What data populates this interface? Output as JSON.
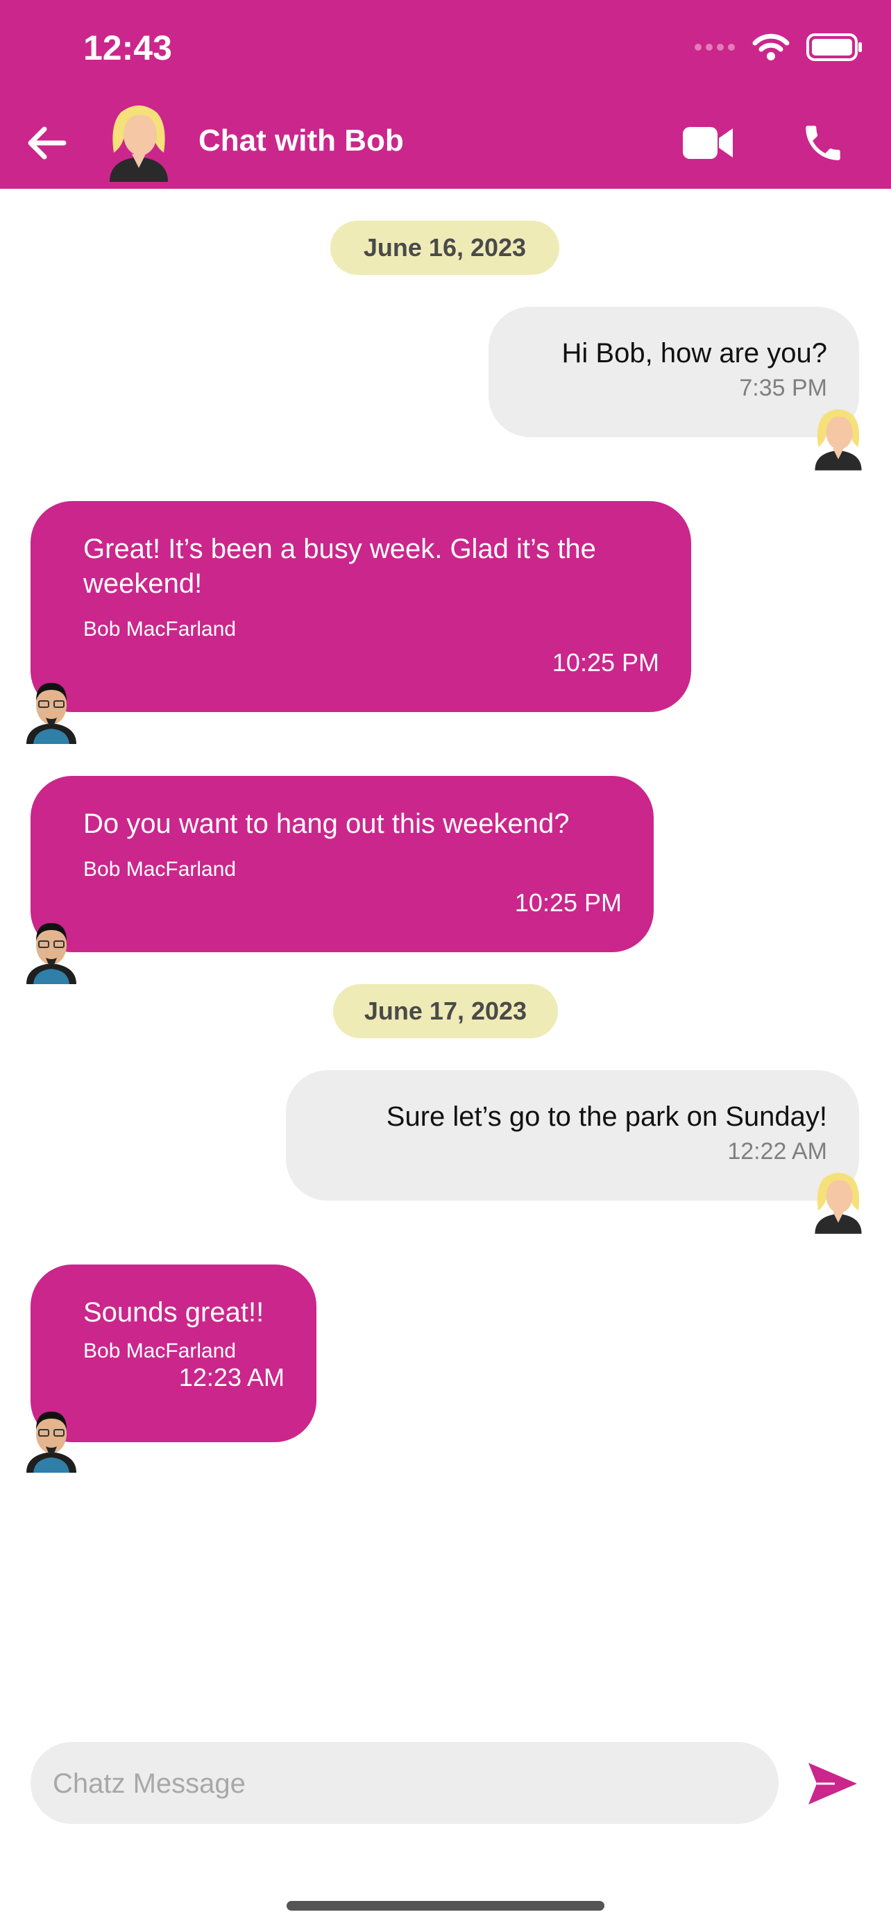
{
  "status_bar": {
    "time": "12:43"
  },
  "app_bar": {
    "title": "Chat with Bob",
    "back_icon": "arrow-left-icon",
    "video_icon": "video-camera-icon",
    "phone_icon": "phone-icon"
  },
  "colors": {
    "primary": "#CB268B",
    "date_pill": "#EFEBB6",
    "outgoing_bubble": "#EDEDED"
  },
  "messages": {
    "date_1": "June 16, 2023",
    "m1": {
      "text": "Hi Bob, how are you?",
      "time": "7:35 PM"
    },
    "m2": {
      "text": "Great! It’s been a busy week. Glad it’s the weekend!",
      "sender": "Bob MacFarland",
      "time": "10:25 PM"
    },
    "m3": {
      "text": "Do you want to hang out this weekend?",
      "sender": "Bob MacFarland",
      "time": "10:25 PM"
    },
    "date_2": "June 17, 2023",
    "m4": {
      "text": "Sure let’s go to the park on Sunday!",
      "time": "12:22 AM"
    },
    "m5": {
      "text": "Sounds great!!",
      "sender": "Bob MacFarland",
      "time": "12:23 AM"
    }
  },
  "composer": {
    "placeholder": "Chatz Message",
    "value": "",
    "send_icon": "send-icon"
  }
}
